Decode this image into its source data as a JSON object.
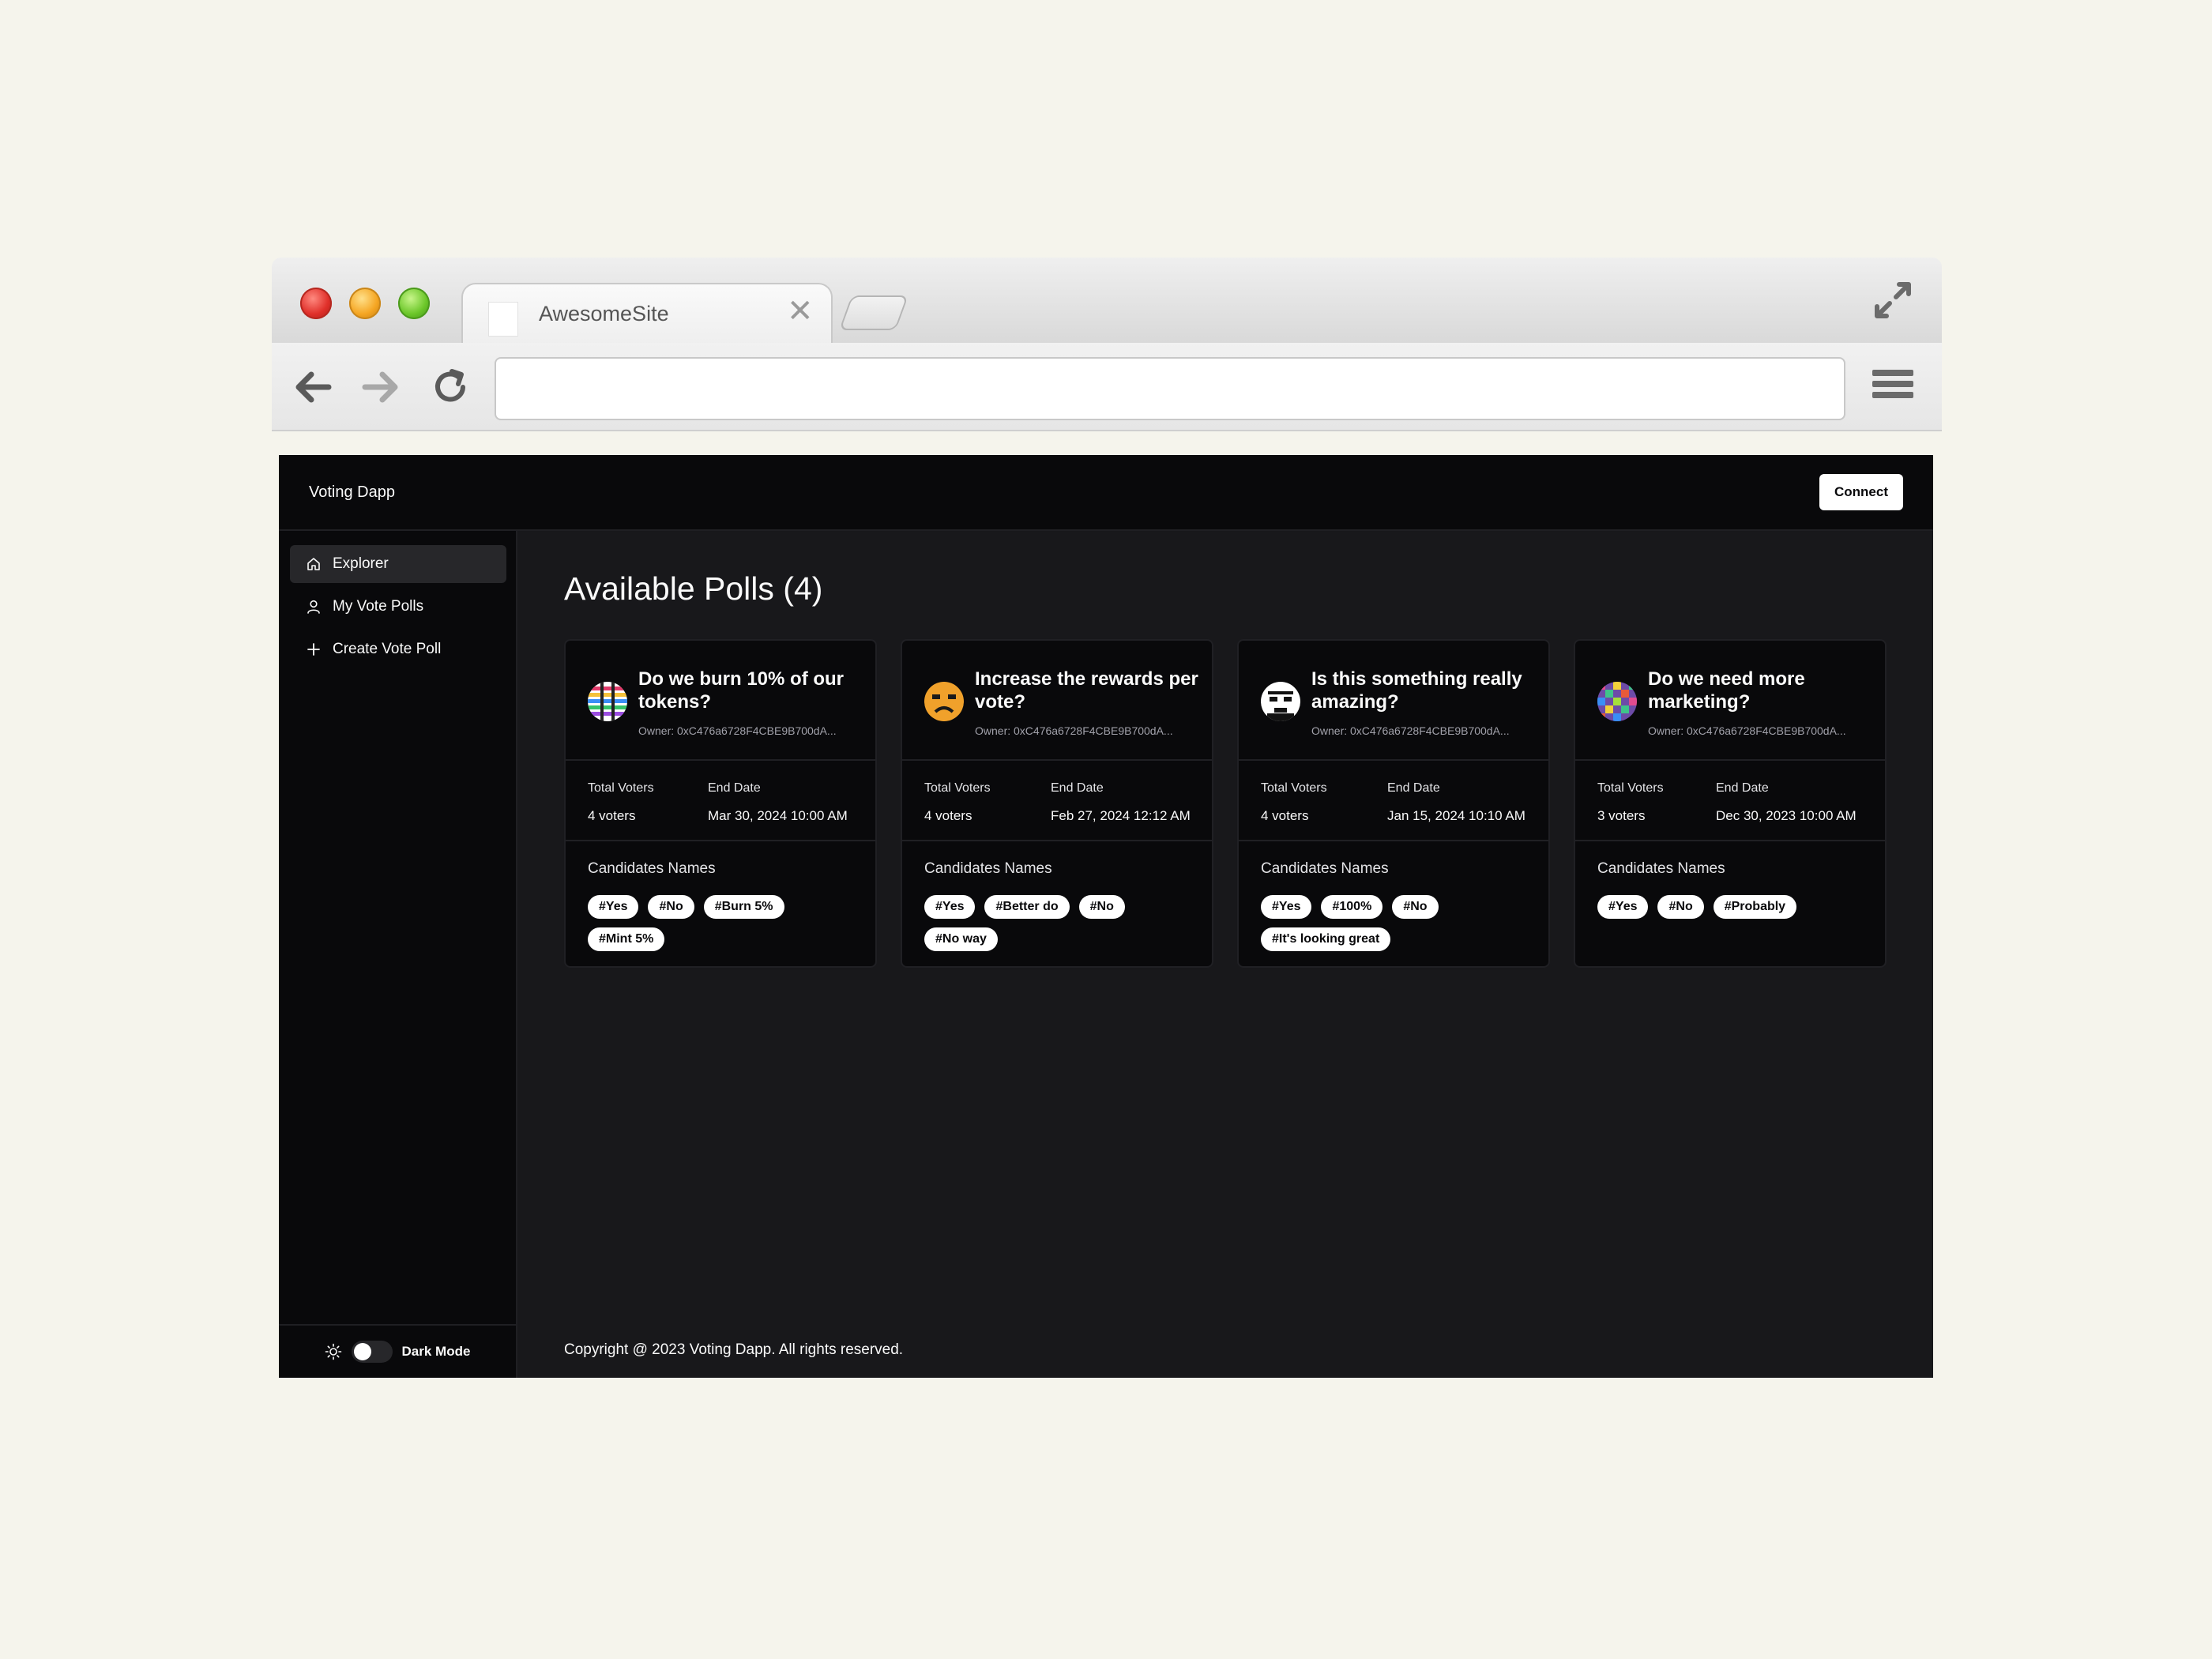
{
  "browser": {
    "tab_title": "AwesomeSite",
    "tab_close": "✕",
    "address_value": ""
  },
  "app": {
    "name": "Voting Dapp",
    "connect_label": "Connect",
    "sidebar": {
      "items": [
        {
          "label": "Explorer",
          "icon": "home-icon",
          "active": true
        },
        {
          "label": "My Vote Polls",
          "icon": "user-icon",
          "active": false
        },
        {
          "label": "Create Vote Poll",
          "icon": "plus-icon",
          "active": false
        }
      ],
      "dark_mode_label": "Dark Mode"
    },
    "page_title": "Available Polls (4)",
    "labels": {
      "total_voters": "Total Voters",
      "end_date": "End Date",
      "candidates": "Candidates Names"
    },
    "polls": [
      {
        "title": "Do we burn 10% of our tokens?",
        "owner": "Owner: 0xC476a6728F4CBE9B700dA...",
        "voters": "4 voters",
        "end_date": "Mar 30, 2024 10:00 AM",
        "candidates": [
          "#Yes",
          "#No",
          "#Burn 5%",
          "#Mint 5%"
        ],
        "avatar": "striped-avatar"
      },
      {
        "title": "Increase the rewards per vote?",
        "owner": "Owner: 0xC476a6728F4CBE9B700dA...",
        "voters": "4 voters",
        "end_date": "Feb 27, 2024 12:12 AM",
        "candidates": [
          "#Yes",
          "#Better do",
          "#No",
          "#No way"
        ],
        "avatar": "orange-face-avatar"
      },
      {
        "title": "Is this something really amazing?",
        "owner": "Owner: 0xC476a6728F4CBE9B700dA...",
        "voters": "4 voters",
        "end_date": "Jan 15, 2024 10:10 AM",
        "candidates": [
          "#Yes",
          "#100%",
          "#No",
          "#It's looking great"
        ],
        "avatar": "white-face-avatar"
      },
      {
        "title": "Do we need more marketing?",
        "owner": "Owner: 0xC476a6728F4CBE9B700dA...",
        "voters": "3 voters",
        "end_date": "Dec 30, 2023 10:00 AM",
        "candidates": [
          "#Yes",
          "#No",
          "#Probably"
        ],
        "avatar": "mosaic-avatar"
      }
    ],
    "footer": "Copyright @ 2023 Voting Dapp. All rights reserved."
  },
  "colors": {
    "app_bg": "#18181b",
    "panel_bg": "#09090b",
    "border": "#202024",
    "chip_bg": "#ffffff"
  }
}
